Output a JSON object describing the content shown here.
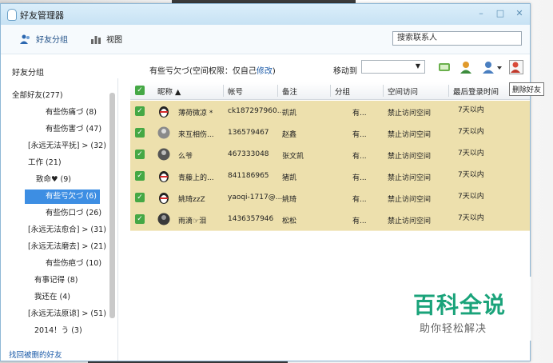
{
  "window": {
    "title": "好友管理器"
  },
  "toolbar": {
    "group_tab": "好友分组",
    "view_tab": "视图",
    "search_placeholder": "搜索联系人"
  },
  "left": {
    "title": "好友分组",
    "restore_link": "找回被删的好友",
    "items": [
      "全部好友(277)",
      "有些伤痛づ (8)",
      "有些伤害づ (47)",
      "[永远无法平抚] > (32)",
      "工作 (21)",
      "致命♥ (9)",
      "有些亏欠づ (6)",
      "有些伤口づ (26)",
      "[永远无法愈合] > (31)",
      "[永远无法磨去] > (21)",
      "有些伤疤づ (10)",
      "有事记得 (8)",
      "我还在 (4)",
      "[永远无法原谅] > (51)",
      "2014！う (3)"
    ]
  },
  "info": {
    "perm_prefix": "有些亏欠づ(空间权限：仅自己",
    "perm_link": "修改",
    "perm_suffix": ")",
    "move_to": "移动到",
    "tooltip": "删除好友"
  },
  "table": {
    "headers": [
      "昵称 ▲",
      "帐号",
      "备注",
      "分组",
      "空间访问",
      "最后登录时间"
    ],
    "rows": [
      {
        "nick": "薄荷微凉 *",
        "account": "ck187297960...",
        "remark": "凯凯",
        "group": "有...",
        "space": "禁止访问空间",
        "last": "7天以内"
      },
      {
        "nick": "来互相伤...",
        "account": "136579467",
        "remark": "赵鑫",
        "group": "有...",
        "space": "禁止访问空间",
        "last": "7天以内"
      },
      {
        "nick": "么爷",
        "account": "467333048",
        "remark": "张文凯",
        "group": "有...",
        "space": "禁止访问空间",
        "last": "7天以内"
      },
      {
        "nick": "青藤上的...",
        "account": "841186965",
        "remark": "猪凯",
        "group": "有...",
        "space": "禁止访问空间",
        "last": "7天以内"
      },
      {
        "nick": "姚琦zzZ",
        "account": "yaoqi-1717@...",
        "remark": "姚琦",
        "group": "有...",
        "space": "禁止访问空间",
        "last": "7天以内"
      },
      {
        "nick": "雨滴☞泪",
        "account": "1436357946",
        "remark": "松松",
        "group": "有...",
        "space": "禁止访问空间",
        "last": "7天以内"
      }
    ]
  },
  "watermark": {
    "title": "百科全说",
    "sub": "助你轻松解决"
  },
  "colors": {
    "row_bg": "#ede0ad",
    "check": "#45a845",
    "selected": "#3d8ee3",
    "link": "#1a5aa8"
  }
}
